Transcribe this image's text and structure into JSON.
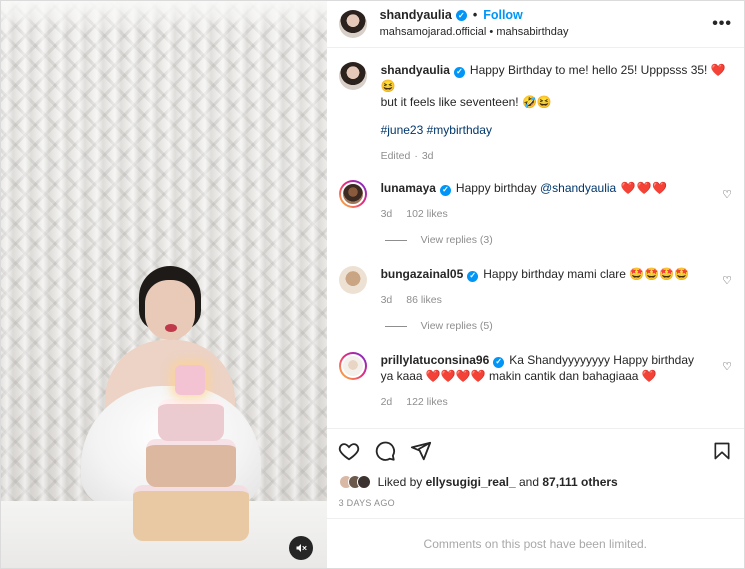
{
  "header": {
    "username": "shandyaulia",
    "follow_label": "Follow",
    "collaborators": "mahsamojarad.official",
    "audio": "mahsabirthday",
    "bullet": "•",
    "more_label": "•••"
  },
  "caption": {
    "username": "shandyaulia",
    "text_line1": "Happy Birthday to me! hello 25! Upppsss 35! ❤️ 😆",
    "text_line2": "but it feels like seventeen! 🤣😆",
    "hashtags": "#june23 #mybirthday",
    "edited": "Edited",
    "time": "3d"
  },
  "comments": [
    {
      "username": "lunamaya",
      "text_prefix": "Happy birthday ",
      "mention": "@shandyaulia",
      "text_suffix": " ❤️❤️❤️",
      "time": "3d",
      "likes": "102 likes",
      "replies": "View replies (3)"
    },
    {
      "username": "bungazainal05",
      "text_prefix": "Happy birthday mami clare ",
      "mention": "",
      "text_suffix": "🤩🤩🤩🤩",
      "time": "3d",
      "likes": "86 likes",
      "replies": "View replies (5)"
    },
    {
      "username": "prillylatuconsina96",
      "text_prefix": "Ka Shandyyyyyyyy Happy birthday ya kaaa ❤️❤️❤️❤️ makin cantik dan bahagiaaa ❤️",
      "mention": "",
      "text_suffix": "",
      "time": "2d",
      "likes": "122 likes",
      "replies": ""
    }
  ],
  "likes": {
    "prefix": "Liked by ",
    "user": "ellysugigi_real_",
    "middle": " and ",
    "count": "87,111 others"
  },
  "post_date": "3 DAYS AGO",
  "comments_limited": "Comments on this post have been limited.",
  "icons": {
    "verified": "verified-badge-icon",
    "heart": "heart-icon",
    "comment": "comment-icon",
    "share": "share-icon",
    "bookmark": "bookmark-icon",
    "sound": "sound-off-icon"
  },
  "colors": {
    "accent": "#0095f6",
    "link": "#00376b",
    "muted": "#8e8e8e"
  }
}
